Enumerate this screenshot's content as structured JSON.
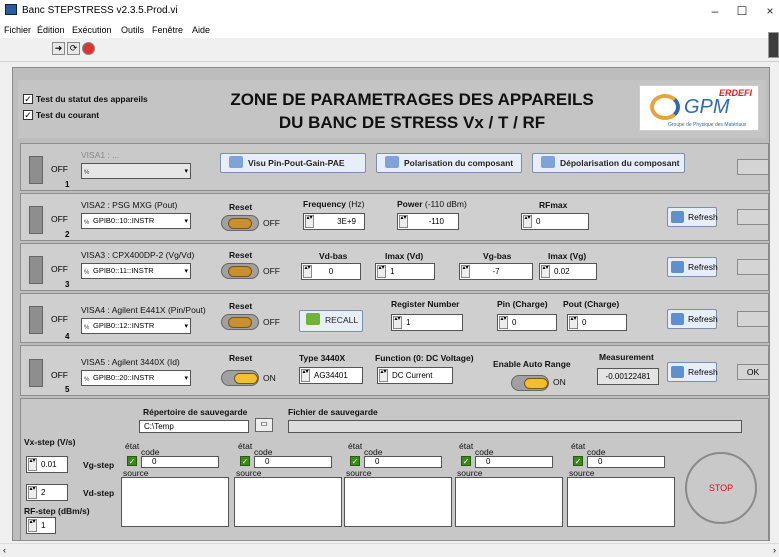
{
  "window": {
    "title": "Banc STEPSTRESS v2.3.5.Prod.vi",
    "minimize": "–",
    "maximize": "☐",
    "close": "×"
  },
  "menu": [
    "Fichier",
    "Édition",
    "Exécution",
    "Outils",
    "Fenêtre",
    "Aide"
  ],
  "header": {
    "check1": "Test du statut des appareils",
    "check2": "Test du courant",
    "title1": "ZONE DE PARAMETRAGES DES APPAREILS",
    "title2": "DU BANC DE STRESS Vx / T / RF",
    "logo_top": "ERDEFI",
    "logo_main": "GPM",
    "logo_sub": "Groupe de Physique des Matériaux"
  },
  "p1": {
    "led": "OFF",
    "num": "1",
    "visa": "VISA1 : ...",
    "btn1": "Visu Pin-Pout-Gain-PAE",
    "btn2": "Polarisation du composant",
    "btn3": "Dépolarisation du composant"
  },
  "p2": {
    "led": "OFF",
    "num": "2",
    "visa": "VISA2 : PSG MXG (Pout)",
    "visa_val": "GPIB0::10::INSTR",
    "reset": "Reset",
    "toggle": "OFF",
    "freq_lbl": "Frequency",
    "freq_unit": "(Hz)",
    "freq": "3E+9",
    "pow_lbl": "Power",
    "pow_unit": "(-110 dBm)",
    "pow": "-110",
    "rfmax_lbl": "RFmax",
    "rfmax": "0",
    "refresh": "Refresh"
  },
  "p3": {
    "led": "OFF",
    "num": "3",
    "visa": "VISA3 : CPX400DP-2 (Vg/Vd)",
    "visa_val": "GPIB0::11::INSTR",
    "reset": "Reset",
    "toggle": "OFF",
    "vdbas_lbl": "Vd-bas",
    "vdbas": "0",
    "imaxvd_lbl": "Imax (Vd)",
    "imaxvd": "1",
    "vgbas_lbl": "Vg-bas",
    "vgbas": "-7",
    "imaxvg_lbl": "Imax (Vg)",
    "imaxvg": "0.02",
    "refresh": "Refresh"
  },
  "p4": {
    "led": "OFF",
    "num": "4",
    "visa": "VISA4 : Agilent E441X (Pin/Pout)",
    "visa_val": "GPIB0::12::INSTR",
    "reset": "Reset",
    "toggle": "OFF",
    "recall": "RECALL",
    "reg_lbl": "Register Number",
    "reg": "1",
    "pin_lbl": "Pin (Charge)",
    "pin": "0",
    "pout_lbl": "Pout (Charge)",
    "pout": "0",
    "refresh": "Refresh"
  },
  "p5": {
    "led": "OFF",
    "num": "5",
    "visa": "VISA5 : Agilent 3440X (Id)",
    "visa_val": "GPIB0::20::INSTR",
    "reset": "Reset",
    "toggle": "ON",
    "type_lbl": "Type 3440X",
    "type": "AG34401",
    "func_lbl": "Function (0: DC Voltage)",
    "func": "DC Current",
    "auto_lbl": "Enable Auto Range",
    "auto": "ON",
    "meas_lbl": "Measurement",
    "meas": "-0.00122481",
    "refresh": "Refresh",
    "status": "OK"
  },
  "bottom": {
    "rep_lbl": "Répertoire de sauvegarde",
    "rep": "C:\\Temp",
    "fich_lbl": "Fichier de sauvegarde",
    "fich": "",
    "vxstep_lbl": "Vx-step (V/s)",
    "vxstep": "0.01",
    "vgstep_lbl": "Vg-step",
    "vdstep_val": "2",
    "vdstep_lbl": "Vd-step",
    "rfstep_lbl": "RF-step (dBm/s)",
    "rfstep": "1",
    "etat": "état",
    "code": "code",
    "source": "source",
    "code_val": "0",
    "stop": "STOP"
  }
}
